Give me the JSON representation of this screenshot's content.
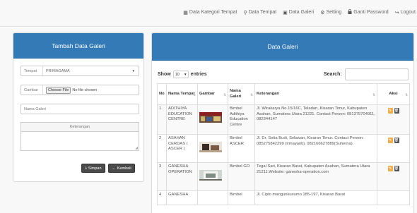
{
  "nav": {
    "items": [
      {
        "icon": "grid-icon",
        "glyph": "▦",
        "label": "Data Kategori Tempat"
      },
      {
        "icon": "map-marker-icon",
        "glyph": "⚲",
        "label": "Data Tempat"
      },
      {
        "icon": "picture-icon",
        "glyph": "▣",
        "label": "Data Galeri"
      },
      {
        "icon": "gear-icon",
        "glyph": "⚙",
        "label": "Setting"
      },
      {
        "icon": "lock-icon",
        "glyph": "🔒",
        "label": "Ganti Password"
      },
      {
        "icon": "logout-icon",
        "glyph": "↪",
        "label": "Logout"
      }
    ]
  },
  "form": {
    "title": "Tambah Data Galeri",
    "tempat_label": "Tempat",
    "tempat_value": "PRIMAGAMA",
    "gambar_label": "Gambar",
    "choose_file": "Choose File",
    "no_file": "No file chosen",
    "nama_galeri_placeholder": "Nama Galeri",
    "keterangan_label": "Keterangan",
    "simpan": "Simpan",
    "kembali": "Kembali"
  },
  "table": {
    "title": "Data Galeri",
    "show_label": "Show",
    "entries_value": "10",
    "entries_label": "entries",
    "search_label": "Search:",
    "headers": [
      "No",
      "Nama Tempat",
      "Gambar",
      "Nama Galeri",
      "Keterangan",
      "Aksi"
    ],
    "rows": [
      {
        "no": "1",
        "tempat": "ADITHIYA EDUCATION CENTRE",
        "galeri": "Bimbel Adithiya Education Centre",
        "keterangan": "Jl. Wirakarya No.15/16C, Teladan, Kisaran Timur, Kabupaten Asahan, Sumatera Utara 21221. Contact Person: 081375704911, 082344147"
      },
      {
        "no": "2",
        "tempat": "ASAHAN CERDAS ( ASCER )",
        "galeri": "Bimbel ASCER",
        "keterangan": "Jl. Dr. Setia Budi, Selawan, Kisaran Timur. Contact Person: 085275842299 (Irmayanti), 082166627889(Suherna)."
      },
      {
        "no": "3",
        "tempat": "GANESHA OPERATION",
        "galeri": "Bimbel GO",
        "keterangan": "Tegal Sari, Kisaran Barat, Kabupaten Asahan, Sumatera Utara 21211.Website: ganesha-operation.com"
      },
      {
        "no": "4",
        "tempat": "GANESHA",
        "galeri": "Bimbel",
        "keterangan": "Jl. Cipto mangunkusumo 185-197, Kisaran Barat"
      }
    ]
  },
  "colors": {
    "panel_header": "#337ab7",
    "edit_button": "#f0ad4e",
    "delete_button": "#555555"
  }
}
